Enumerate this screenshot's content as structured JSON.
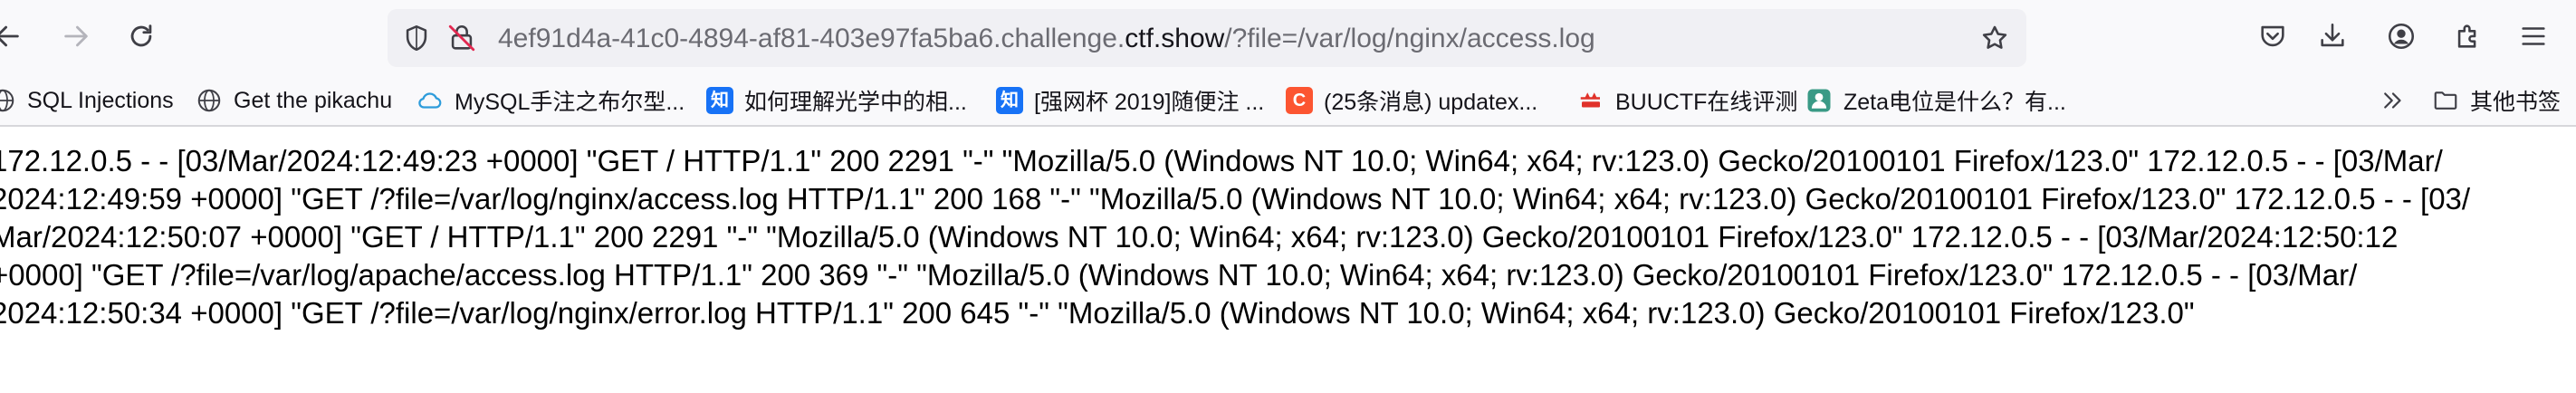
{
  "toolbar": {
    "back_icon": "arrow-left-icon",
    "forward_icon": "arrow-right-icon",
    "reload_icon": "reload-icon",
    "url": {
      "prefix": "4ef91d4a-41c0-4894-af81-403e97fa5ba6.challenge.",
      "host": "ctf.show",
      "path": "/?file=/var/log/nginx/access.log"
    },
    "right_icons": [
      "pocket-icon",
      "download-icon",
      "account-icon",
      "extensions-icon",
      "menu-icon"
    ]
  },
  "bookmarks": {
    "items": [
      {
        "label": "SQL Injections",
        "icon": "globe-icon"
      },
      {
        "label": "Get the pikachu",
        "icon": "globe-icon"
      },
      {
        "label": "MySQL手注之布尔型...",
        "icon": "cloud-icon"
      },
      {
        "label": "如何理解光学中的相...",
        "icon": "zhihu-icon",
        "icon_text": "知"
      },
      {
        "label": "[强网杯 2019]随便注 ...",
        "icon": "zhihu-icon",
        "icon_text": "知"
      },
      {
        "label": "(25条消息) updatex...",
        "icon": "csdn-icon",
        "icon_text": "C"
      },
      {
        "label": "BUUCTF在线评测",
        "icon": "buuctf-icon"
      },
      {
        "label": "Zeta电位是什么？有...",
        "icon": "zeta-icon"
      }
    ],
    "other_bookmarks": "其他书签"
  },
  "content": {
    "lines": [
      "172.12.0.5 - - [03/Mar/2024:12:49:23 +0000] \"GET / HTTP/1.1\" 200 2291 \"-\" \"Mozilla/5.0 (Windows NT 10.0; Win64; x64; rv:123.0) Gecko/20100101 Firefox/123.0\" 172.12.0.5 - - [03/Mar/",
      "2024:12:49:59 +0000] \"GET /?file=/var/log/nginx/access.log HTTP/1.1\" 200 168 \"-\" \"Mozilla/5.0 (Windows NT 10.0; Win64; x64; rv:123.0) Gecko/20100101 Firefox/123.0\" 172.12.0.5 - - [03/",
      "Mar/2024:12:50:07 +0000] \"GET / HTTP/1.1\" 200 2291 \"-\" \"Mozilla/5.0 (Windows NT 10.0; Win64; x64; rv:123.0) Gecko/20100101 Firefox/123.0\" 172.12.0.5 - - [03/Mar/2024:12:50:12",
      "+0000] \"GET /?file=/var/log/apache/access.log HTTP/1.1\" 200 369 \"-\" \"Mozilla/5.0 (Windows NT 10.0; Win64; x64; rv:123.0) Gecko/20100101 Firefox/123.0\" 172.12.0.5 - - [03/Mar/",
      "2024:12:50:34 +0000] \"GET /?file=/var/log/nginx/error.log HTTP/1.1\" 200 645 \"-\" \"Mozilla/5.0 (Windows NT 10.0; Win64; x64; rv:123.0) Gecko/20100101 Firefox/123.0\""
    ]
  },
  "colors": {
    "toolbar_bg": "#f9f9fb",
    "urlbar_bg": "#f0f0f4",
    "icon": "#5b5b66",
    "url_text": "#6b6b72",
    "zhihu": "#1772f6",
    "csdn": "#fc5531",
    "buuctf": "#e0322a",
    "zeta": "#3a9a86"
  }
}
